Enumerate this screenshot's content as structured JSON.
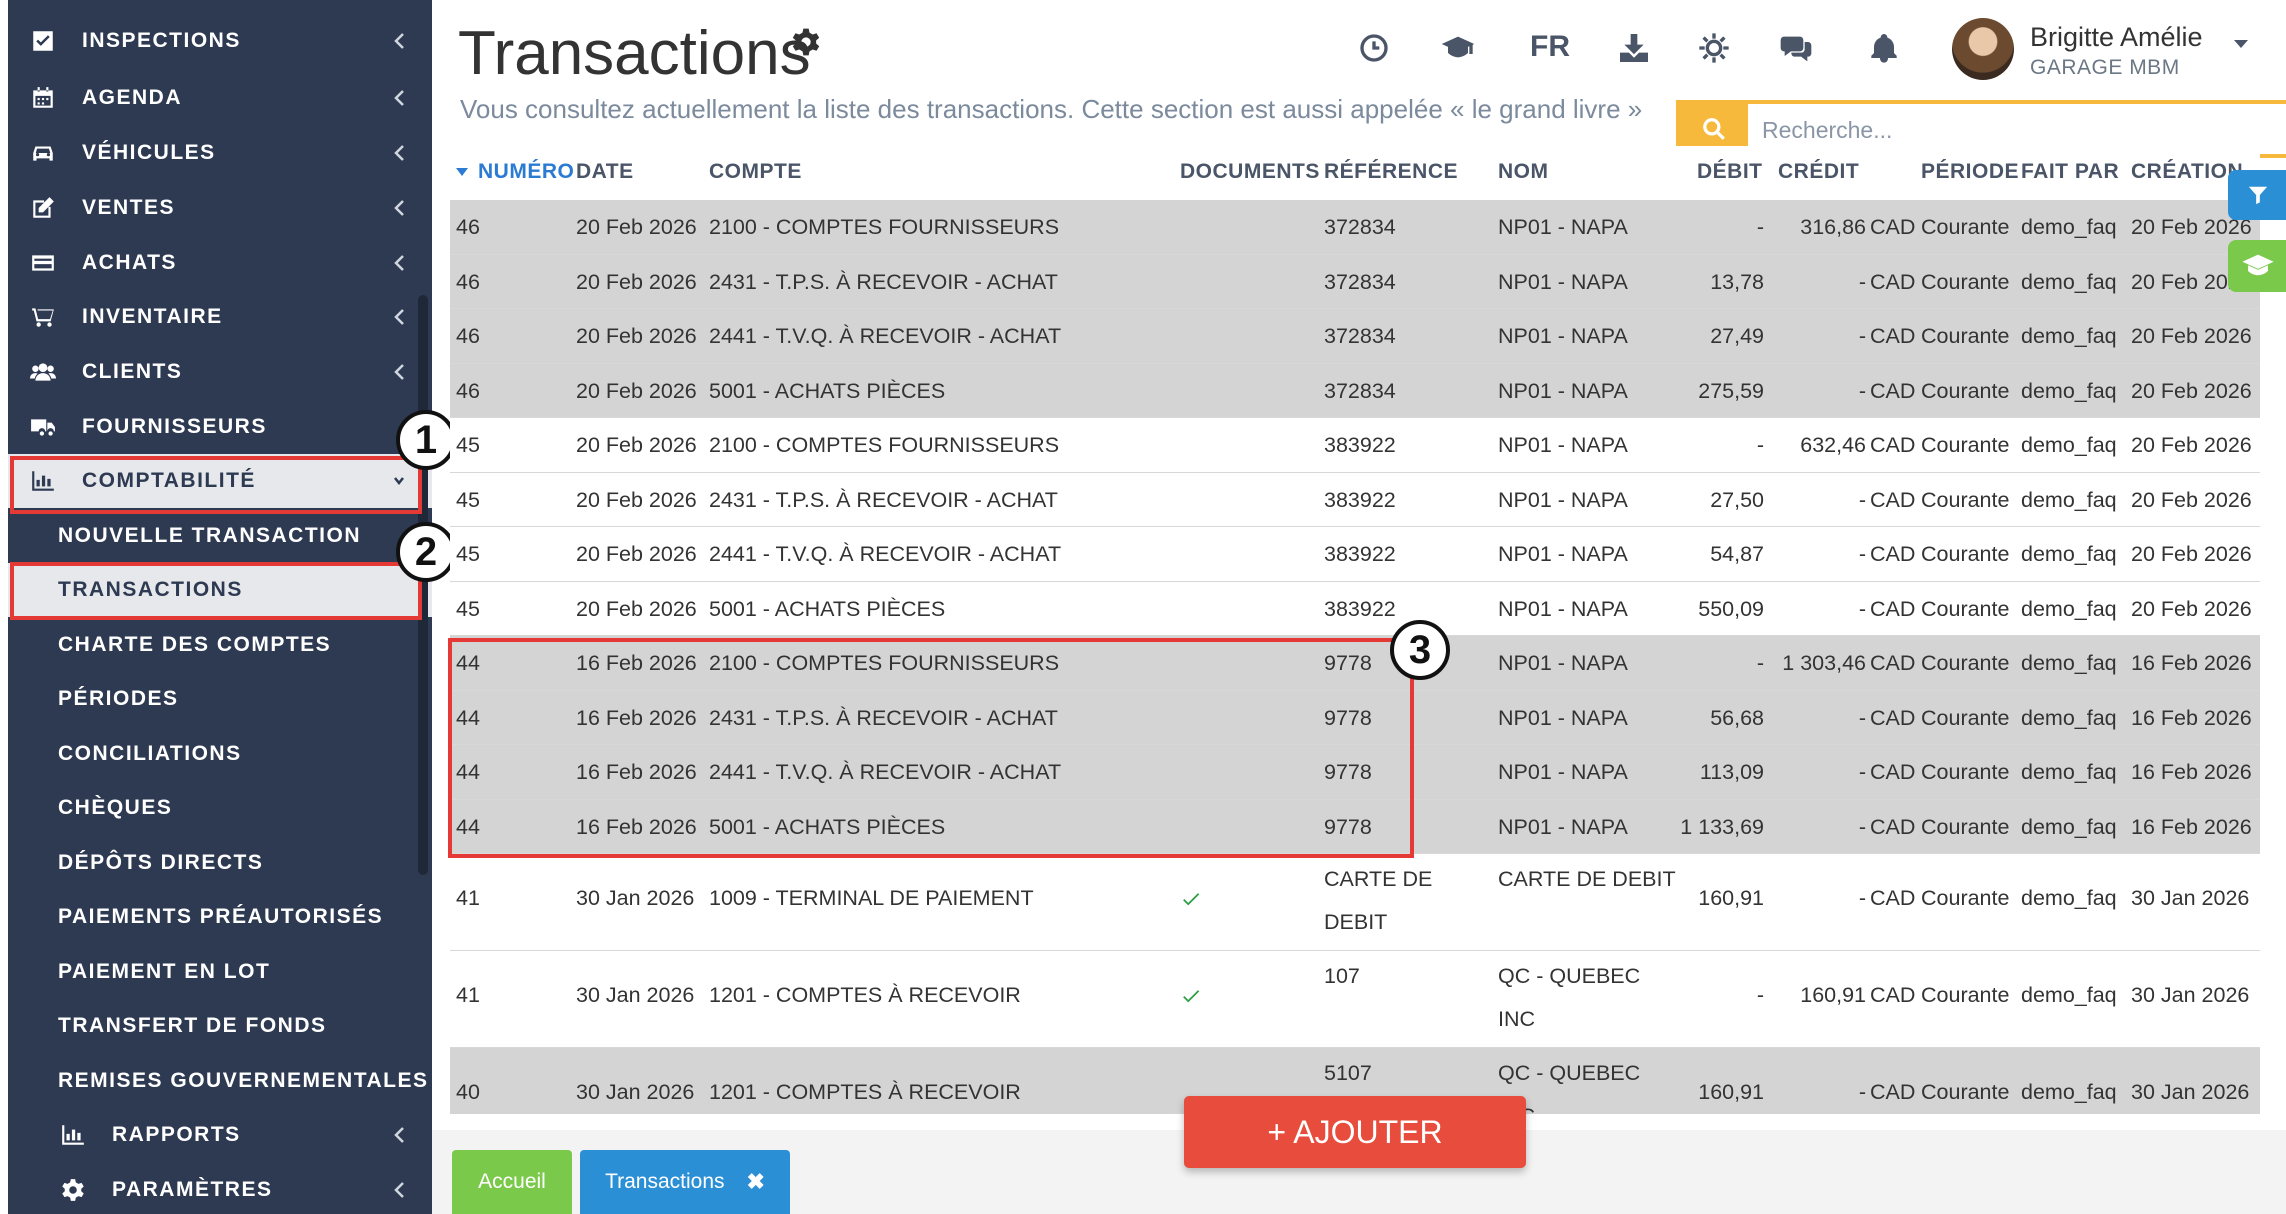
{
  "sidebar": {
    "items": [
      {
        "label": "INSPECTIONS"
      },
      {
        "label": "AGENDA"
      },
      {
        "label": "VÉHICULES"
      },
      {
        "label": "VENTES"
      },
      {
        "label": "ACHATS"
      },
      {
        "label": "INVENTAIRE"
      },
      {
        "label": "CLIENTS"
      },
      {
        "label": "FOURNISSEURS"
      },
      {
        "label": "COMPTABILITÉ"
      }
    ],
    "sub_items": [
      {
        "label": "NOUVELLE TRANSACTION"
      },
      {
        "label": "TRANSACTIONS"
      },
      {
        "label": "CHARTE DES COMPTES"
      },
      {
        "label": "PÉRIODES"
      },
      {
        "label": "CONCILIATIONS"
      },
      {
        "label": "CHÈQUES"
      },
      {
        "label": "DÉPÔTS DIRECTS"
      },
      {
        "label": "PAIEMENTS PRÉAUTORISÉS"
      },
      {
        "label": "PAIEMENT EN LOT"
      },
      {
        "label": "TRANSFERT DE FONDS"
      },
      {
        "label": "REMISES GOUVERNEMENTALES"
      }
    ],
    "bottom_items": [
      {
        "label": "RAPPORTS"
      },
      {
        "label": "PARAMÈTRES"
      }
    ]
  },
  "callouts": [
    "1",
    "2",
    "3"
  ],
  "header": {
    "title": "Transactions",
    "subtitle": "Vous consultez actuellement la liste des transactions. Cette section est aussi appelée « le grand livre »",
    "lang": "FR",
    "user_name": "Brigitte Amélie",
    "user_company": "GARAGE MBM",
    "search_placeholder": "Recherche..."
  },
  "table": {
    "headers": {
      "numero": "NUMÉRO",
      "date": "DATE",
      "compte": "COMPTE",
      "documents": "DOCUMENTS",
      "reference": "RÉFÉRENCE",
      "nom": "NOM",
      "debit": "DÉBIT",
      "credit": "CRÉDIT",
      "periode": "PÉRIODE",
      "fait_par": "FAIT PAR",
      "creation": "CRÉATION"
    },
    "rows": [
      {
        "num": "46",
        "date": "20 Feb 2026",
        "compte": "2100 - COMPTES FOURNISSEURS",
        "doc": false,
        "ref": "372834",
        "nom": "NP01 - NAPA",
        "debit": "-",
        "credit": "316,86",
        "devise": "CAD",
        "periode": "Courante",
        "fait_par": "demo_faq",
        "creation": "20 Feb 2026",
        "shade": "grey",
        "tall": false
      },
      {
        "num": "46",
        "date": "20 Feb 2026",
        "compte": "2431 - T.P.S. À RECEVOIR - ACHAT",
        "doc": false,
        "ref": "372834",
        "nom": "NP01 - NAPA",
        "debit": "13,78",
        "credit": "-",
        "devise": "CAD",
        "periode": "Courante",
        "fait_par": "demo_faq",
        "creation": "20 Feb 2026",
        "shade": "grey",
        "tall": false
      },
      {
        "num": "46",
        "date": "20 Feb 2026",
        "compte": "2441 - T.V.Q. À RECEVOIR - ACHAT",
        "doc": false,
        "ref": "372834",
        "nom": "NP01 - NAPA",
        "debit": "27,49",
        "credit": "-",
        "devise": "CAD",
        "periode": "Courante",
        "fait_par": "demo_faq",
        "creation": "20 Feb 2026",
        "shade": "grey",
        "tall": false
      },
      {
        "num": "46",
        "date": "20 Feb 2026",
        "compte": "5001 - ACHATS PIÈCES",
        "doc": false,
        "ref": "372834",
        "nom": "NP01 - NAPA",
        "debit": "275,59",
        "credit": "-",
        "devise": "CAD",
        "periode": "Courante",
        "fait_par": "demo_faq",
        "creation": "20 Feb 2026",
        "shade": "grey",
        "tall": false
      },
      {
        "num": "45",
        "date": "20 Feb 2026",
        "compte": "2100 - COMPTES FOURNISSEURS",
        "doc": false,
        "ref": "383922",
        "nom": "NP01 - NAPA",
        "debit": "-",
        "credit": "632,46",
        "devise": "CAD",
        "periode": "Courante",
        "fait_par": "demo_faq",
        "creation": "20 Feb 2026",
        "shade": "white",
        "tall": false
      },
      {
        "num": "45",
        "date": "20 Feb 2026",
        "compte": "2431 - T.P.S. À RECEVOIR - ACHAT",
        "doc": false,
        "ref": "383922",
        "nom": "NP01 - NAPA",
        "debit": "27,50",
        "credit": "-",
        "devise": "CAD",
        "periode": "Courante",
        "fait_par": "demo_faq",
        "creation": "20 Feb 2026",
        "shade": "white",
        "tall": false
      },
      {
        "num": "45",
        "date": "20 Feb 2026",
        "compte": "2441 - T.V.Q. À RECEVOIR - ACHAT",
        "doc": false,
        "ref": "383922",
        "nom": "NP01 - NAPA",
        "debit": "54,87",
        "credit": "-",
        "devise": "CAD",
        "periode": "Courante",
        "fait_par": "demo_faq",
        "creation": "20 Feb 2026",
        "shade": "white",
        "tall": false
      },
      {
        "num": "45",
        "date": "20 Feb 2026",
        "compte": "5001 - ACHATS PIÈCES",
        "doc": false,
        "ref": "383922",
        "nom": "NP01 - NAPA",
        "debit": "550,09",
        "credit": "-",
        "devise": "CAD",
        "periode": "Courante",
        "fait_par": "demo_faq",
        "creation": "20 Feb 2026",
        "shade": "white",
        "tall": false
      },
      {
        "num": "44",
        "date": "16 Feb 2026",
        "compte": "2100 - COMPTES FOURNISSEURS",
        "doc": false,
        "ref": "9778",
        "nom": "NP01 - NAPA",
        "debit": "-",
        "credit": "1 303,46",
        "devise": "CAD",
        "periode": "Courante",
        "fait_par": "demo_faq",
        "creation": "16 Feb 2026",
        "shade": "grey",
        "tall": false
      },
      {
        "num": "44",
        "date": "16 Feb 2026",
        "compte": "2431 - T.P.S. À RECEVOIR - ACHAT",
        "doc": false,
        "ref": "9778",
        "nom": "NP01 - NAPA",
        "debit": "56,68",
        "credit": "-",
        "devise": "CAD",
        "periode": "Courante",
        "fait_par": "demo_faq",
        "creation": "16 Feb 2026",
        "shade": "grey",
        "tall": false
      },
      {
        "num": "44",
        "date": "16 Feb 2026",
        "compte": "2441 - T.V.Q. À RECEVOIR - ACHAT",
        "doc": false,
        "ref": "9778",
        "nom": "NP01 - NAPA",
        "debit": "113,09",
        "credit": "-",
        "devise": "CAD",
        "periode": "Courante",
        "fait_par": "demo_faq",
        "creation": "16 Feb 2026",
        "shade": "grey",
        "tall": false
      },
      {
        "num": "44",
        "date": "16 Feb 2026",
        "compte": "5001 - ACHATS PIÈCES",
        "doc": false,
        "ref": "9778",
        "nom": "NP01 - NAPA",
        "debit": "1 133,69",
        "credit": "-",
        "devise": "CAD",
        "periode": "Courante",
        "fait_par": "demo_faq",
        "creation": "16 Feb 2026",
        "shade": "grey",
        "tall": false
      },
      {
        "num": "41",
        "date": "30 Jan 2026",
        "compte": "1009 - TERMINAL DE PAIEMENT",
        "doc": true,
        "ref": "CARTE DE DEBIT",
        "nom": "CARTE DE DEBIT",
        "debit": "160,91",
        "credit": "-",
        "devise": "CAD",
        "periode": "Courante",
        "fait_par": "demo_faq",
        "creation": "30 Jan 2026",
        "shade": "white",
        "tall": true
      },
      {
        "num": "41",
        "date": "30 Jan 2026",
        "compte": "1201 - COMPTES À RECEVOIR",
        "doc": true,
        "ref": "107",
        "nom": "QC - QUEBEC INC",
        "debit": "-",
        "credit": "160,91",
        "devise": "CAD",
        "periode": "Courante",
        "fait_par": "demo_faq",
        "creation": "30 Jan 2026",
        "shade": "white",
        "tall": true
      },
      {
        "num": "40",
        "date": "30 Jan 2026",
        "compte": "1201 - COMPTES À RECEVOIR",
        "doc": false,
        "ref": "5107",
        "nom": "QC - QUEBEC INC",
        "debit": "160,91",
        "credit": "-",
        "devise": "CAD",
        "periode": "Courante",
        "fait_par": "demo_faq",
        "creation": "30 Jan 2026",
        "shade": "grey",
        "tall": true
      }
    ]
  },
  "add_button": "+ AJOUTER",
  "tabs": [
    {
      "label": "Accueil"
    },
    {
      "label": "Transactions",
      "close": "✖"
    }
  ],
  "colors": {
    "sidebar_bg": "#2e3a52",
    "accent_blue": "#2b7bd3",
    "highlight_red": "#e53935",
    "search_yellow": "#f6b93b",
    "add_red": "#e74c3c",
    "home_green": "#7bc94b",
    "check_green": "#2e9e47"
  },
  "icons": {
    "sidebar": [
      "checkbox-icon",
      "calendar-icon",
      "car-icon",
      "edit-icon",
      "credit-card-icon",
      "cart-icon",
      "users-icon",
      "truck-icon",
      "bar-chart-icon"
    ],
    "top": [
      "clock-icon",
      "graduation-cap-icon",
      "download-icon",
      "sun-icon",
      "chat-icon",
      "bell-icon"
    ]
  }
}
